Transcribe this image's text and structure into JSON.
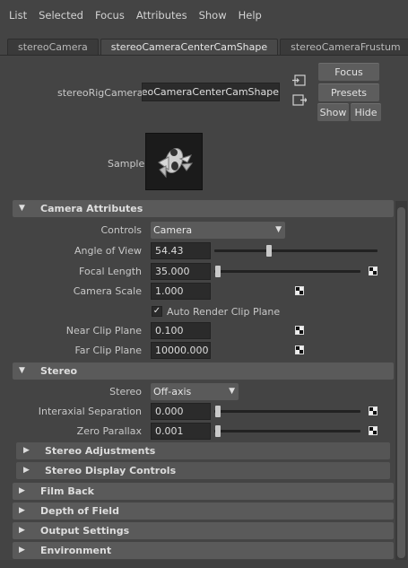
{
  "menu": [
    "List",
    "Selected",
    "Focus",
    "Attributes",
    "Show",
    "Help"
  ],
  "tabs": [
    "stereoCamera",
    "stereoCameraCenterCamShape",
    "stereoCameraFrustum"
  ],
  "active_tab": "stereoCameraCenterCamShape",
  "rig": {
    "label": "stereoRigCamera:",
    "value": "stereoCameraCenterCamShape"
  },
  "buttons": {
    "focus": "Focus",
    "presets": "Presets",
    "show": "Show",
    "hide": "Hide"
  },
  "sample_label": "Sample",
  "camera_attributes": {
    "title": "Camera Attributes",
    "controls_label": "Controls",
    "controls_value": "Camera",
    "angle_of_view_label": "Angle of View",
    "angle_of_view": "54.43",
    "focal_length_label": "Focal Length",
    "focal_length": "35.000",
    "camera_scale_label": "Camera Scale",
    "camera_scale": "1.000",
    "auto_render_clip_label": "Auto Render Clip Plane",
    "auto_render_clip_checked": true,
    "near_clip_label": "Near Clip Plane",
    "near_clip": "0.100",
    "far_clip_label": "Far Clip Plane",
    "far_clip": "10000.000"
  },
  "stereo": {
    "title": "Stereo",
    "stereo_label": "Stereo",
    "stereo_value": "Off-axis",
    "interaxial_label": "Interaxial Separation",
    "interaxial": "0.000",
    "zero_parallax_label": "Zero Parallax",
    "zero_parallax": "0.001",
    "adjustments": "Stereo Adjustments",
    "display_controls": "Stereo Display Controls"
  },
  "sections": {
    "film_back": "Film Back",
    "depth_of_field": "Depth of Field",
    "output_settings": "Output Settings",
    "environment": "Environment"
  }
}
